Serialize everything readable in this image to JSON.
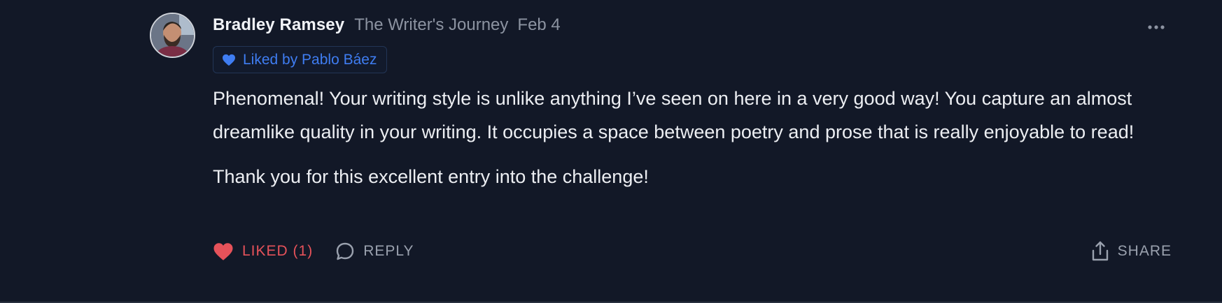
{
  "comment": {
    "author": "Bradley Ramsey",
    "publication": "The Writer's Journey",
    "date": "Feb 4",
    "liked_by": "Liked by Pablo Báez",
    "paragraphs": [
      "Phenomenal! Your writing style is unlike anything I’ve seen on here in a very good way! You capture an almost dreamlike quality in your writing. It occupies a space between poetry and prose that is really enjoyable to read!",
      "Thank you for this excellent entry into the challenge!"
    ]
  },
  "actions": {
    "like_label": "LIKED (1)",
    "reply_label": "REPLY",
    "share_label": "SHARE"
  },
  "icons": {
    "avatar": "avatar-photo",
    "more": "more-horizontal-icon",
    "heart": "heart-icon",
    "reply": "comment-bubble-icon",
    "share": "share-upload-icon"
  },
  "colors": {
    "background": "#121827",
    "liked": "#e6525a",
    "liked_by": "#3f7df2",
    "muted": "#8c93a1"
  }
}
